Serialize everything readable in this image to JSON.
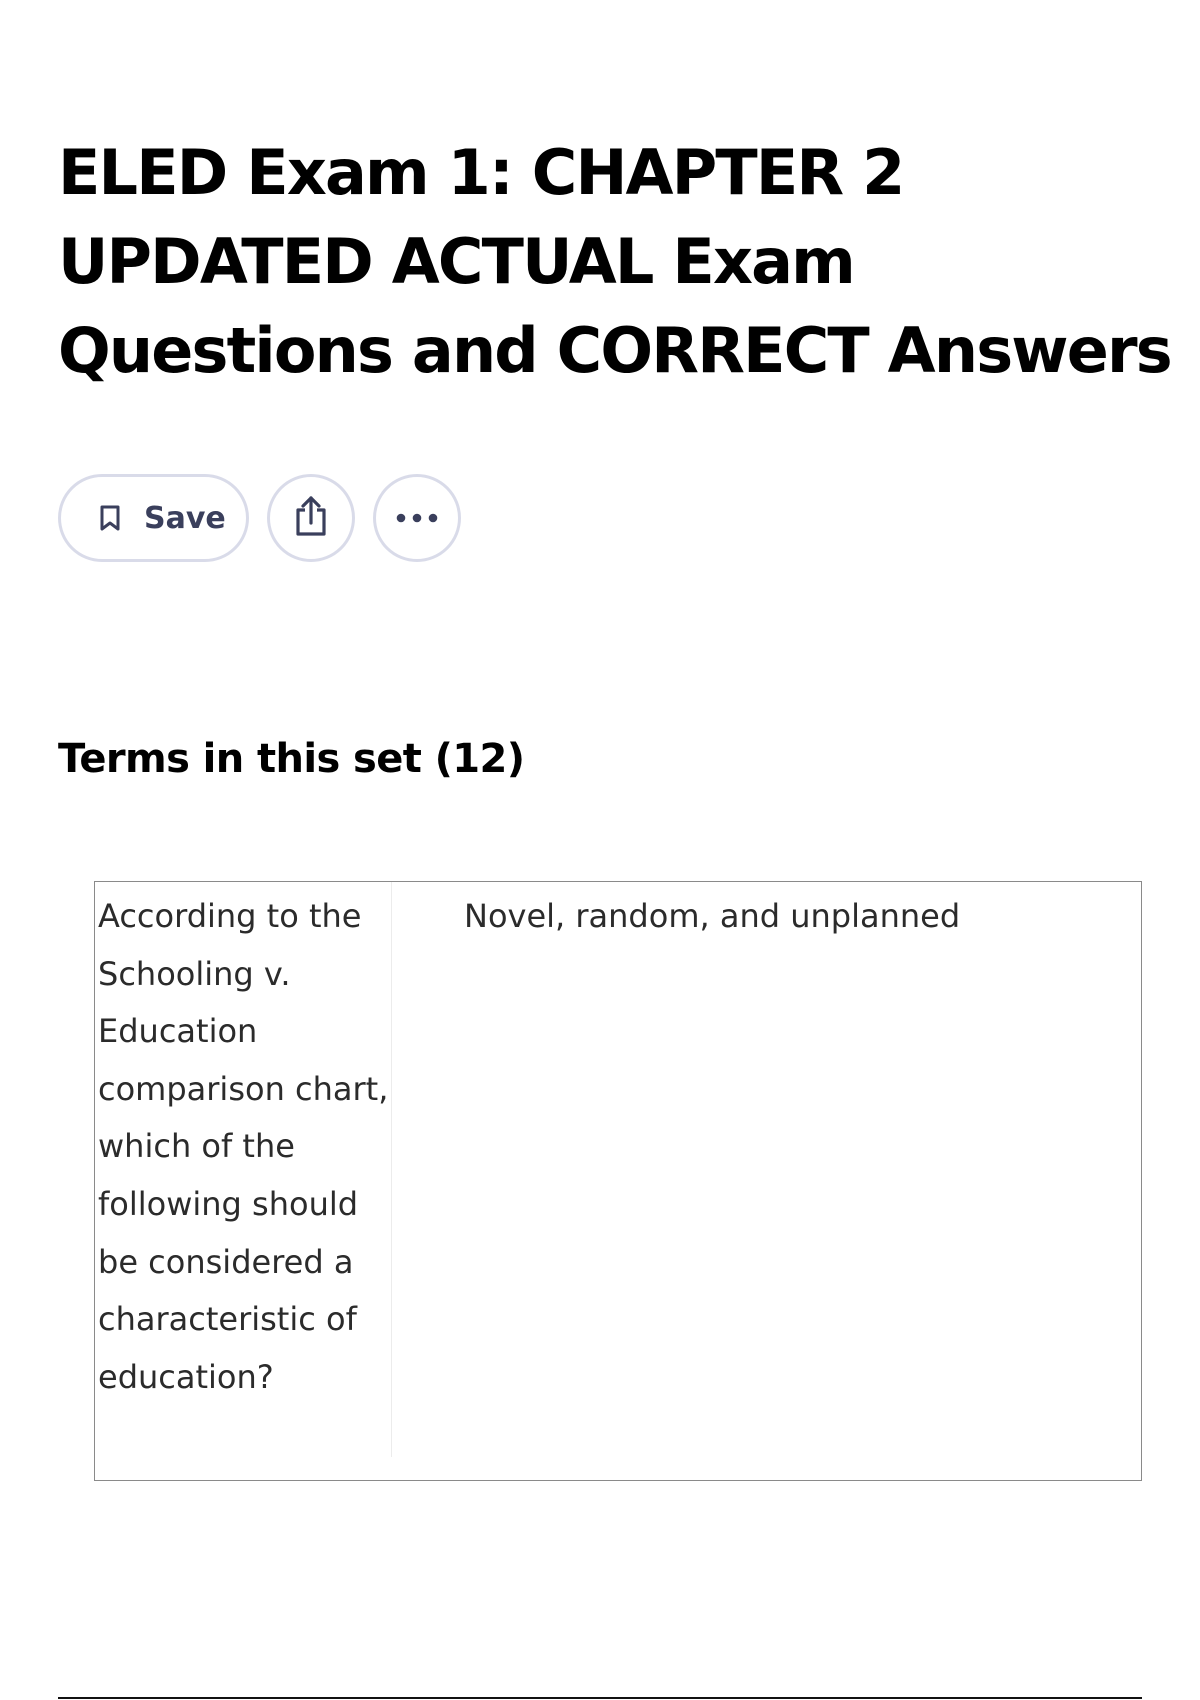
{
  "page": {
    "title": "ELED Exam 1: CHAPTER 2 UPDATED ACTUAL Exam Questions and CORRECT Answers"
  },
  "actions": {
    "save_label": "Save",
    "save_icon": "bookmark-icon",
    "share_icon": "share-icon",
    "more_icon": "more-horizontal-icon"
  },
  "terms_section": {
    "heading": "Terms in this set (12)",
    "cards": [
      {
        "term": "According to the Schooling v. Education comparison chart, which of the following should be considered a characteristic of education?",
        "definition": "Novel, random, and unplanned"
      }
    ]
  },
  "colors": {
    "text": "#000000",
    "button_border": "#d9dbe9",
    "icon": "#3a3f5c",
    "table_border": "#8a8a8a"
  }
}
